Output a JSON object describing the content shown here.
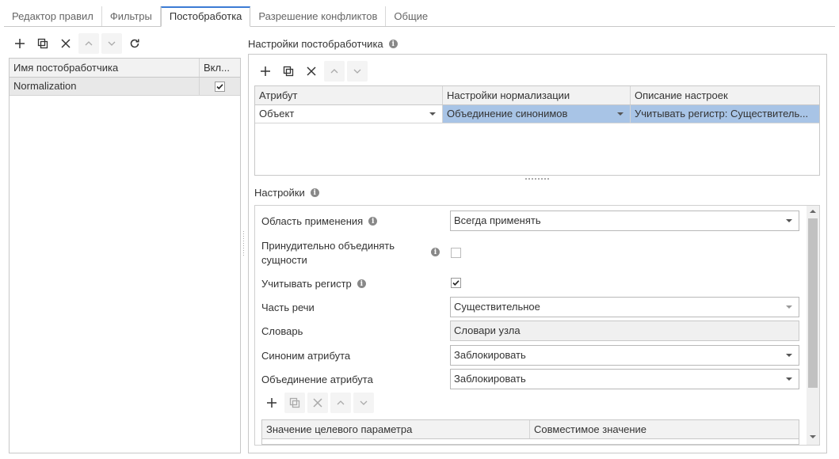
{
  "tabs": [
    {
      "label": "Редактор правил"
    },
    {
      "label": "Фильтры"
    },
    {
      "label": "Постобработка"
    },
    {
      "label": "Разрешение конфликтов"
    },
    {
      "label": "Общие"
    }
  ],
  "left": {
    "columns": [
      "Имя постобработчика",
      "Вкл..."
    ],
    "rows": [
      {
        "name": "Normalization",
        "enabled": true
      }
    ]
  },
  "right": {
    "title": "Настройки постобработчика",
    "columns": [
      "Атрибут",
      "Настройки нормализации",
      "Описание настроек"
    ],
    "row": {
      "attribute": "Объект",
      "normalization": "Объединение синонимов",
      "description": "Учитывать регистр: Существитель..."
    }
  },
  "settings": {
    "title": "Настройки",
    "scope_label": "Область применения",
    "scope_value": "Всегда применять",
    "force_label": "Принудительно объединять сущности",
    "case_label": "Учитывать регистр",
    "case_checked": true,
    "pos_label": "Часть речи",
    "pos_value": "Существительное",
    "dict_label": "Словарь",
    "dict_value": "Словари узла",
    "syn_label": "Синоним атрибута",
    "syn_value": "Заблокировать",
    "merge_label": "Объединение атрибута",
    "merge_value": "Заблокировать",
    "inner_columns": [
      "Значение целевого параметра",
      "Совместимое значение"
    ]
  },
  "colors": {
    "accent": "#3b7bd4",
    "selection": "#a8c4e6"
  }
}
